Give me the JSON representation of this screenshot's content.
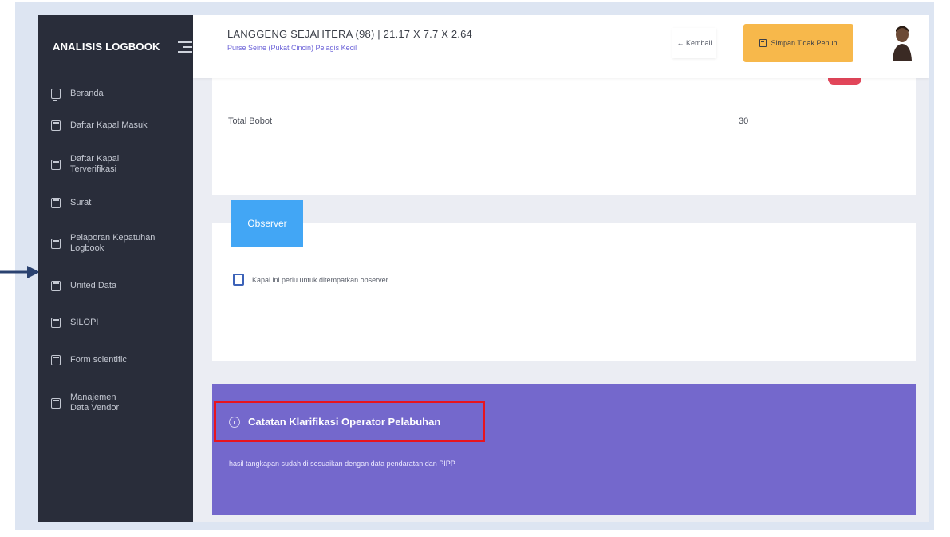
{
  "sidebar": {
    "brand": "ANALISIS LOGBOOK",
    "items": [
      {
        "label": "Beranda",
        "icon": "monitor-icon"
      },
      {
        "label": "Daftar Kapal Masuk",
        "icon": "calendar-icon"
      },
      {
        "label": "Daftar Kapal Terverifikasi",
        "icon": "calendar-icon"
      },
      {
        "label": "Surat",
        "icon": "calendar-icon"
      },
      {
        "label": "Pelaporan Kepatuhan Logbook",
        "icon": "calendar-icon"
      },
      {
        "label": "United Data",
        "icon": "calendar-icon"
      },
      {
        "label": "SILOPI",
        "icon": "calendar-icon"
      },
      {
        "label": "Form scientific",
        "icon": "calendar-icon"
      },
      {
        "label": "Manajemen Data Vendor",
        "icon": "calendar-icon"
      }
    ]
  },
  "header": {
    "vessel_title": "LANGGENG SEJAHTERA (98) | 21.17 X 7.7 X 2.64",
    "vessel_subtitle": "Purse Seine (Pukat Cincin) Pelagis Kecil",
    "back_label": "← Kembali",
    "save_label": "Simpan Tidak Penuh"
  },
  "summary": {
    "total_label": "Total Bobot",
    "total_value": "30"
  },
  "observer": {
    "tab_label": "Observer",
    "checkbox_label": "Kapal ini perlu untuk ditempatkan observer",
    "checked": false
  },
  "note": {
    "title": "Catatan Klarifikasi Operator Pelabuhan",
    "body": "hasil tangkapan sudah di sesuaikan dengan data pendaratan dan PIPP"
  },
  "colors": {
    "sidebar_bg": "#292d3a",
    "accent_purple": "#7468cc",
    "observer_blue": "#42a6f5",
    "save_yellow": "#f7b84b",
    "highlight_red": "#e8141e"
  }
}
